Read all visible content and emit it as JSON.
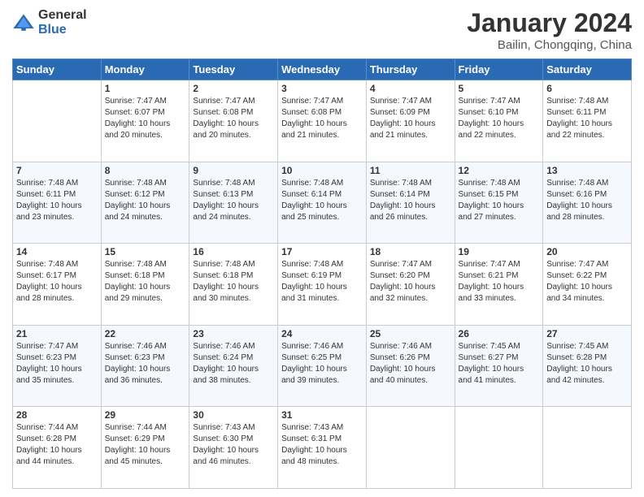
{
  "header": {
    "logo": {
      "general": "General",
      "blue": "Blue"
    },
    "title": "January 2024",
    "location": "Bailin, Chongqing, China"
  },
  "days_of_week": [
    "Sunday",
    "Monday",
    "Tuesday",
    "Wednesday",
    "Thursday",
    "Friday",
    "Saturday"
  ],
  "weeks": [
    [
      {
        "day": "",
        "sunrise": "",
        "sunset": "",
        "daylight": ""
      },
      {
        "day": "1",
        "sunrise": "Sunrise: 7:47 AM",
        "sunset": "Sunset: 6:07 PM",
        "daylight": "Daylight: 10 hours and 20 minutes."
      },
      {
        "day": "2",
        "sunrise": "Sunrise: 7:47 AM",
        "sunset": "Sunset: 6:08 PM",
        "daylight": "Daylight: 10 hours and 20 minutes."
      },
      {
        "day": "3",
        "sunrise": "Sunrise: 7:47 AM",
        "sunset": "Sunset: 6:08 PM",
        "daylight": "Daylight: 10 hours and 21 minutes."
      },
      {
        "day": "4",
        "sunrise": "Sunrise: 7:47 AM",
        "sunset": "Sunset: 6:09 PM",
        "daylight": "Daylight: 10 hours and 21 minutes."
      },
      {
        "day": "5",
        "sunrise": "Sunrise: 7:47 AM",
        "sunset": "Sunset: 6:10 PM",
        "daylight": "Daylight: 10 hours and 22 minutes."
      },
      {
        "day": "6",
        "sunrise": "Sunrise: 7:48 AM",
        "sunset": "Sunset: 6:11 PM",
        "daylight": "Daylight: 10 hours and 22 minutes."
      }
    ],
    [
      {
        "day": "7",
        "sunrise": "Sunrise: 7:48 AM",
        "sunset": "Sunset: 6:11 PM",
        "daylight": "Daylight: 10 hours and 23 minutes."
      },
      {
        "day": "8",
        "sunrise": "Sunrise: 7:48 AM",
        "sunset": "Sunset: 6:12 PM",
        "daylight": "Daylight: 10 hours and 24 minutes."
      },
      {
        "day": "9",
        "sunrise": "Sunrise: 7:48 AM",
        "sunset": "Sunset: 6:13 PM",
        "daylight": "Daylight: 10 hours and 24 minutes."
      },
      {
        "day": "10",
        "sunrise": "Sunrise: 7:48 AM",
        "sunset": "Sunset: 6:14 PM",
        "daylight": "Daylight: 10 hours and 25 minutes."
      },
      {
        "day": "11",
        "sunrise": "Sunrise: 7:48 AM",
        "sunset": "Sunset: 6:14 PM",
        "daylight": "Daylight: 10 hours and 26 minutes."
      },
      {
        "day": "12",
        "sunrise": "Sunrise: 7:48 AM",
        "sunset": "Sunset: 6:15 PM",
        "daylight": "Daylight: 10 hours and 27 minutes."
      },
      {
        "day": "13",
        "sunrise": "Sunrise: 7:48 AM",
        "sunset": "Sunset: 6:16 PM",
        "daylight": "Daylight: 10 hours and 28 minutes."
      }
    ],
    [
      {
        "day": "14",
        "sunrise": "Sunrise: 7:48 AM",
        "sunset": "Sunset: 6:17 PM",
        "daylight": "Daylight: 10 hours and 28 minutes."
      },
      {
        "day": "15",
        "sunrise": "Sunrise: 7:48 AM",
        "sunset": "Sunset: 6:18 PM",
        "daylight": "Daylight: 10 hours and 29 minutes."
      },
      {
        "day": "16",
        "sunrise": "Sunrise: 7:48 AM",
        "sunset": "Sunset: 6:18 PM",
        "daylight": "Daylight: 10 hours and 30 minutes."
      },
      {
        "day": "17",
        "sunrise": "Sunrise: 7:48 AM",
        "sunset": "Sunset: 6:19 PM",
        "daylight": "Daylight: 10 hours and 31 minutes."
      },
      {
        "day": "18",
        "sunrise": "Sunrise: 7:47 AM",
        "sunset": "Sunset: 6:20 PM",
        "daylight": "Daylight: 10 hours and 32 minutes."
      },
      {
        "day": "19",
        "sunrise": "Sunrise: 7:47 AM",
        "sunset": "Sunset: 6:21 PM",
        "daylight": "Daylight: 10 hours and 33 minutes."
      },
      {
        "day": "20",
        "sunrise": "Sunrise: 7:47 AM",
        "sunset": "Sunset: 6:22 PM",
        "daylight": "Daylight: 10 hours and 34 minutes."
      }
    ],
    [
      {
        "day": "21",
        "sunrise": "Sunrise: 7:47 AM",
        "sunset": "Sunset: 6:23 PM",
        "daylight": "Daylight: 10 hours and 35 minutes."
      },
      {
        "day": "22",
        "sunrise": "Sunrise: 7:46 AM",
        "sunset": "Sunset: 6:23 PM",
        "daylight": "Daylight: 10 hours and 36 minutes."
      },
      {
        "day": "23",
        "sunrise": "Sunrise: 7:46 AM",
        "sunset": "Sunset: 6:24 PM",
        "daylight": "Daylight: 10 hours and 38 minutes."
      },
      {
        "day": "24",
        "sunrise": "Sunrise: 7:46 AM",
        "sunset": "Sunset: 6:25 PM",
        "daylight": "Daylight: 10 hours and 39 minutes."
      },
      {
        "day": "25",
        "sunrise": "Sunrise: 7:46 AM",
        "sunset": "Sunset: 6:26 PM",
        "daylight": "Daylight: 10 hours and 40 minutes."
      },
      {
        "day": "26",
        "sunrise": "Sunrise: 7:45 AM",
        "sunset": "Sunset: 6:27 PM",
        "daylight": "Daylight: 10 hours and 41 minutes."
      },
      {
        "day": "27",
        "sunrise": "Sunrise: 7:45 AM",
        "sunset": "Sunset: 6:28 PM",
        "daylight": "Daylight: 10 hours and 42 minutes."
      }
    ],
    [
      {
        "day": "28",
        "sunrise": "Sunrise: 7:44 AM",
        "sunset": "Sunset: 6:28 PM",
        "daylight": "Daylight: 10 hours and 44 minutes."
      },
      {
        "day": "29",
        "sunrise": "Sunrise: 7:44 AM",
        "sunset": "Sunset: 6:29 PM",
        "daylight": "Daylight: 10 hours and 45 minutes."
      },
      {
        "day": "30",
        "sunrise": "Sunrise: 7:43 AM",
        "sunset": "Sunset: 6:30 PM",
        "daylight": "Daylight: 10 hours and 46 minutes."
      },
      {
        "day": "31",
        "sunrise": "Sunrise: 7:43 AM",
        "sunset": "Sunset: 6:31 PM",
        "daylight": "Daylight: 10 hours and 48 minutes."
      },
      {
        "day": "",
        "sunrise": "",
        "sunset": "",
        "daylight": ""
      },
      {
        "day": "",
        "sunrise": "",
        "sunset": "",
        "daylight": ""
      },
      {
        "day": "",
        "sunrise": "",
        "sunset": "",
        "daylight": ""
      }
    ]
  ]
}
